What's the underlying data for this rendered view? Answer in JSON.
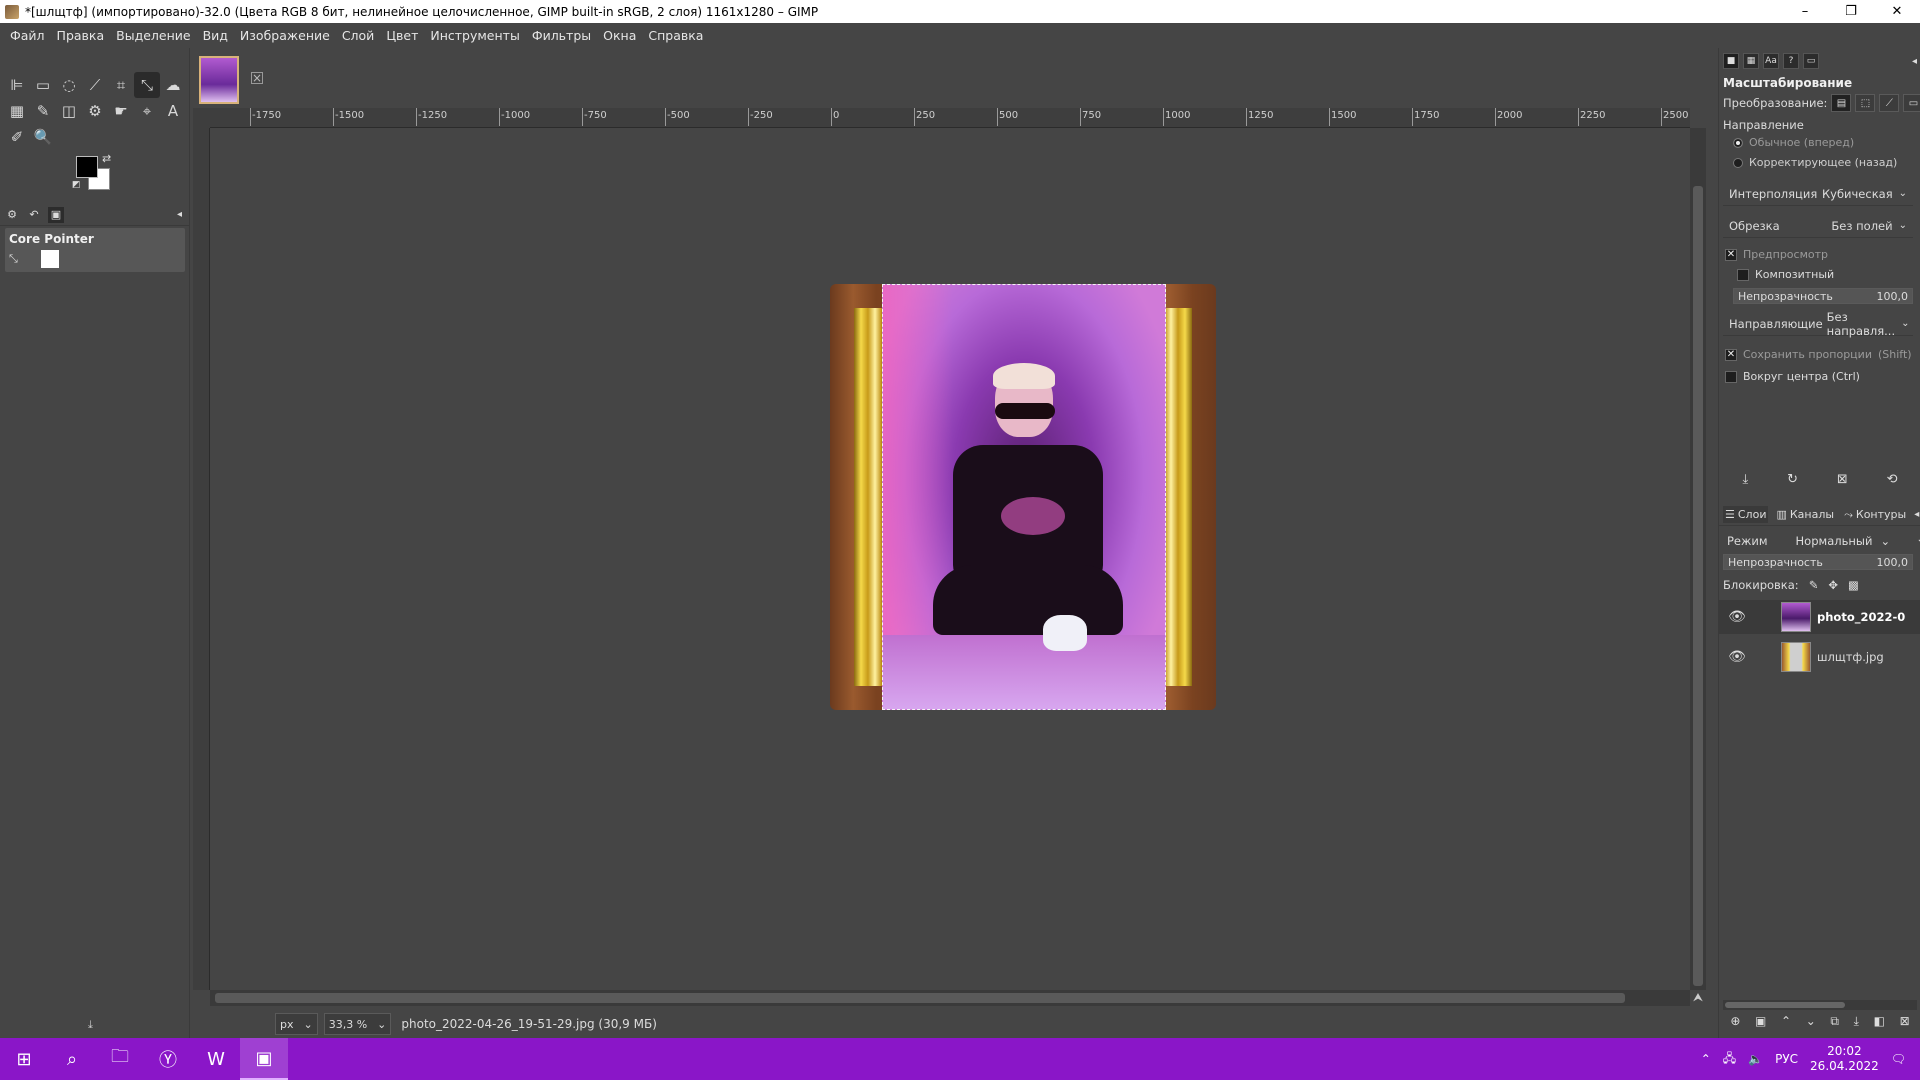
{
  "window": {
    "title": "*[шлщтф] (импортировано)-32.0 (Цвета RGB 8 бит, нелинейное целочисленное, GIMP built-in sRGB, 2 слоя) 1161x1280 – GIMP",
    "minimize": "–",
    "maximize": "❐",
    "close": "✕"
  },
  "menu": [
    "Файл",
    "Правка",
    "Выделение",
    "Вид",
    "Изображение",
    "Слой",
    "Цвет",
    "Инструменты",
    "Фильтры",
    "Окна",
    "Справка"
  ],
  "toolbox": {
    "tools": [
      "align-icon",
      "rect-select-icon",
      "lasso-icon",
      "fuzzy-select-icon",
      "crop-icon",
      "scale-icon",
      "warp-icon",
      "gradient-icon",
      "paintbrush-icon",
      "eraser-icon",
      "clone-icon",
      "smudge-icon",
      "paths-icon",
      "text-icon",
      "color-picker-icon",
      "zoom-icon"
    ],
    "tool_glyphs": [
      "⊫",
      "▭",
      "◌",
      "⟋",
      "⌗",
      "⤡",
      "☁",
      "▦",
      "✎",
      "◫",
      "⚙",
      "☛",
      "⌖",
      "A",
      "✐",
      "🔍"
    ],
    "device_name": "Core Pointer"
  },
  "ruler": {
    "ticks": [
      "-1750",
      "-1500",
      "-1250",
      "-1000",
      "-750",
      "-500",
      "-250",
      "0",
      "250",
      "500",
      "750",
      "1000",
      "1250",
      "1500",
      "1750",
      "2000",
      "2250",
      "2500"
    ]
  },
  "statusbar": {
    "unit": "px",
    "zoom": "33,3 %",
    "file": "photo_2022-04-26_19-51-29.jpg (30,9 МБ)"
  },
  "tool_options": {
    "title": "Масштабирование",
    "transform_label": "Преобразование:",
    "direction_label": "Направление",
    "direction_normal": "Обычное (вперед)",
    "direction_corrective": "Корректирующее (назад)",
    "interpolation_label": "Интерполяция",
    "interpolation_value": "Кубическая",
    "clipping_label": "Обрезка",
    "clipping_value": "Без полей",
    "preview_label": "Предпросмотр",
    "composite_label": "Композитный",
    "opacity_label": "Непрозрачность",
    "opacity_value": "100,0",
    "guides_label": "Направляющие",
    "guides_value": "Без направля...",
    "keep_aspect_label": "Сохранить пропорции",
    "keep_aspect_hint": "(Shift)",
    "around_center_label": "Вокруг центра (Ctrl)"
  },
  "layers_panel": {
    "tab_layers": "Слои",
    "tab_channels": "Каналы",
    "tab_paths": "Контуры",
    "mode_label": "Режим",
    "mode_value": "Нормальный",
    "opacity_label": "Непрозрачность",
    "opacity_value": "100,0",
    "lock_label": "Блокировка:",
    "layers": [
      {
        "name": "photo_2022-0",
        "selected": true
      },
      {
        "name": "шлщтф.jpg",
        "selected": false
      }
    ]
  },
  "taskbar": {
    "language": "РУС",
    "time": "20:02",
    "date": "26.04.2022"
  },
  "colors": {
    "taskbar": "#8a16c8",
    "ui_bg": "#454545",
    "frame_gold": "#f5d94a",
    "frame_wood": "#9a5a2e"
  }
}
